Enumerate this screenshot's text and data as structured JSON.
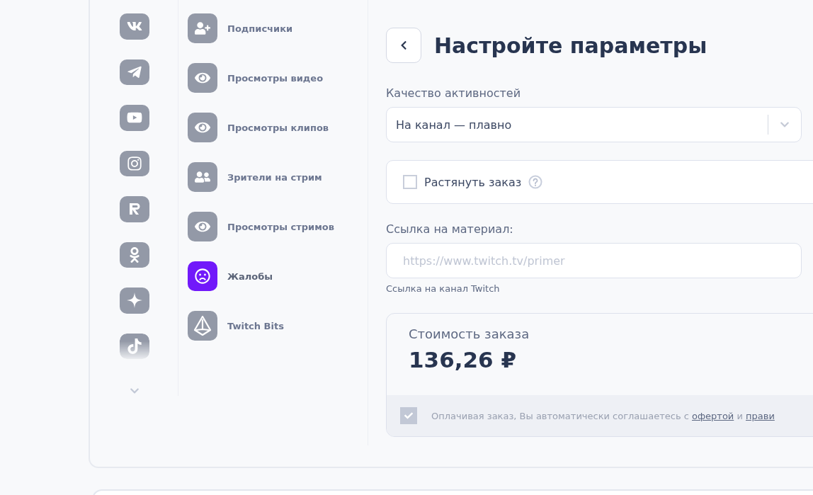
{
  "services": [
    {
      "label": "Подписчики",
      "selected": false
    },
    {
      "label": "Просмотры видео",
      "selected": false
    },
    {
      "label": "Просмотры клипов",
      "selected": false
    },
    {
      "label": "Зрители на стрим",
      "selected": false
    },
    {
      "label": "Просмотры стримов",
      "selected": false
    },
    {
      "label": "Жалобы",
      "selected": true
    },
    {
      "label": "Twitch Bits",
      "selected": false
    }
  ],
  "settings": {
    "title": "Настройте параметры",
    "quality": {
      "label": "Качество активностей",
      "value": "На канал — плавно"
    },
    "stretch": {
      "label": "Растянуть заказ",
      "checked": false
    },
    "link": {
      "label": "Ссылка на материал:",
      "placeholder": "https://www.twitch.tv/primer",
      "hint": "Ссылка на канал Twitch"
    },
    "cost": {
      "label": "Стоимость заказа",
      "value": "136,26 ₽"
    },
    "terms": {
      "text": "Оплачивая заказ, Вы автоматически соглашаетесь с ",
      "link_1": "офертой",
      "between": " и ",
      "link_2": "прави",
      "checked": true
    }
  }
}
